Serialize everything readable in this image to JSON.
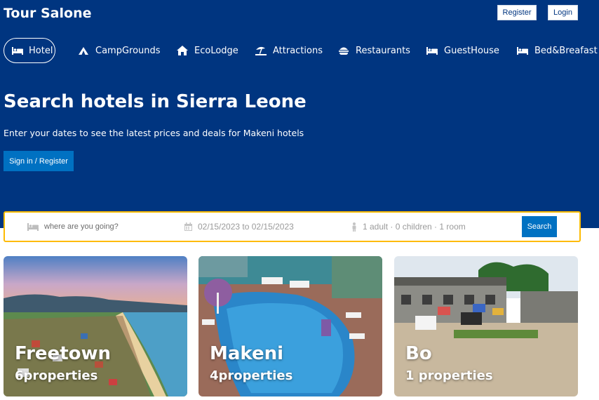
{
  "header": {
    "brand": "Tour Salone",
    "register_label": "Register",
    "login_label": "Login"
  },
  "nav": {
    "items": [
      {
        "label": "Hotel",
        "icon": "bed-icon",
        "active": true
      },
      {
        "label": "CampGrounds",
        "icon": "tent-icon"
      },
      {
        "label": "EcoLodge",
        "icon": "home-icon"
      },
      {
        "label": "Attractions",
        "icon": "umbrella-beach-icon"
      },
      {
        "label": "Restaurants",
        "icon": "burger-icon"
      },
      {
        "label": "GuestHouse",
        "icon": "bed-icon"
      },
      {
        "label": "Bed&Breafast",
        "icon": "bed-icon"
      }
    ]
  },
  "hero": {
    "title": "Search hotels in Sierra Leone",
    "subtitle": "Enter your dates to see the latest prices and deals for Makeni hotels",
    "cta_label": "Sign in / Register"
  },
  "search": {
    "destination_placeholder": "where are you going?",
    "dates": "02/15/2023 to 02/15/2023",
    "guests": "1 adult · 0 children · 1 room",
    "search_label": "Search"
  },
  "destinations": [
    {
      "city": "Freetown",
      "properties": "6properties"
    },
    {
      "city": "Makeni",
      "properties": "4properties"
    },
    {
      "city": "Bo",
      "properties": "1 properties"
    }
  ],
  "colors": {
    "brand_blue": "#003580",
    "accent_blue": "#0071c2",
    "search_border": "#febb02"
  }
}
